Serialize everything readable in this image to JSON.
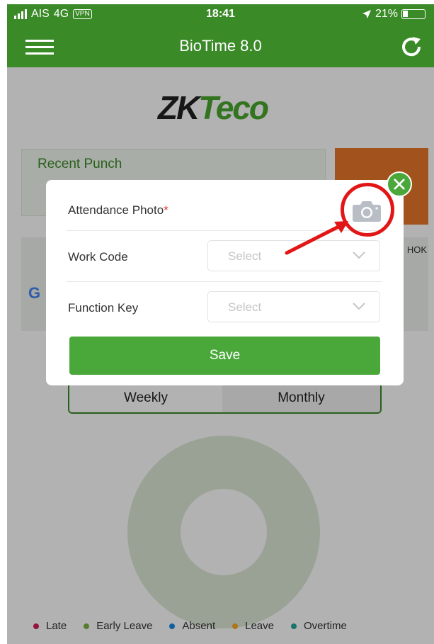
{
  "status_bar": {
    "carrier": "AIS",
    "network": "4G",
    "vpn": "VPN",
    "time": "18:41",
    "battery": "21%"
  },
  "header": {
    "title": "BioTime 8.0"
  },
  "logo": {
    "text_dark": "ZK",
    "text_accent": "Teco"
  },
  "recent_punch": {
    "title": "Recent Punch"
  },
  "map": {
    "google_mark": "G",
    "label_partial": "HOK"
  },
  "tabs": [
    {
      "label": "Weekly"
    },
    {
      "label": "Monthly"
    }
  ],
  "legend": [
    {
      "label": "Late",
      "color": "#d81b60"
    },
    {
      "label": "Early Leave",
      "color": "#7cb342"
    },
    {
      "label": "Absent",
      "color": "#1e88e5"
    },
    {
      "label": "Leave",
      "color": "#f9a825"
    },
    {
      "label": "Overtime",
      "color": "#26a69a"
    }
  ],
  "modal": {
    "attendance_photo_label": "Attendance Photo",
    "required_mark": "*",
    "work_code_label": "Work Code",
    "work_code_placeholder": "Select",
    "function_key_label": "Function Key",
    "function_key_placeholder": "Select",
    "save_label": "Save"
  },
  "colors": {
    "brand_green": "#3a8a28",
    "button_green": "#4aa83a",
    "annotation_red": "#e21616",
    "orange_card": "#e8762a"
  }
}
